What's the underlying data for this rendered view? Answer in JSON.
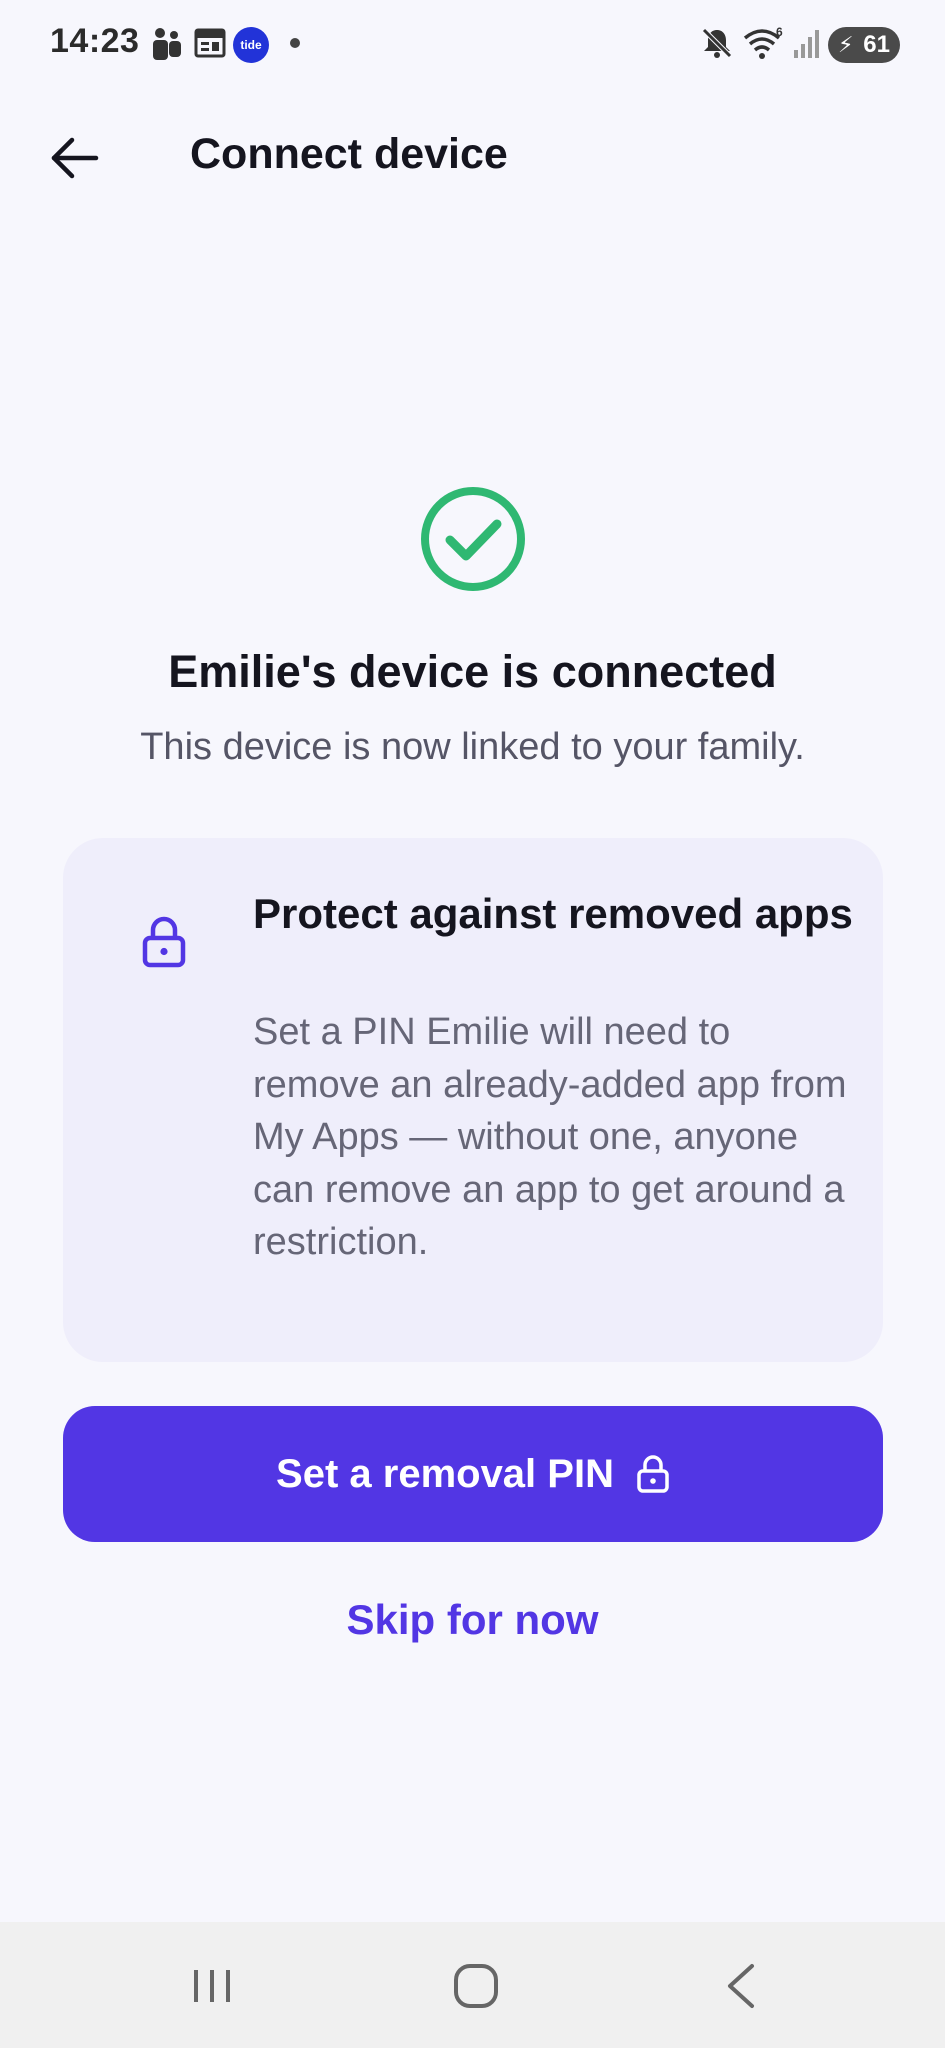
{
  "status_bar": {
    "time": "14:23",
    "icons": [
      "teams-icon",
      "calendar-icon",
      "tide-app-icon",
      "notification-dot",
      "mute-icon",
      "wifi-icon",
      "signal-icon"
    ],
    "tide_label": "tide",
    "battery": "61"
  },
  "header": {
    "title": "Connect device"
  },
  "success": {
    "title": "Emilie's device is connected",
    "subtitle": "This device is now linked to your family."
  },
  "card": {
    "title": "Protect against removed apps",
    "body": "Set a PIN Emilie will need to remove an already-added app from My Apps — without one, anyone can remove an app to get around a restriction."
  },
  "actions": {
    "primary_label": "Set a removal PIN",
    "skip_label": "Skip for now"
  },
  "colors": {
    "accent": "#5236e4",
    "success": "#2fb872",
    "card_bg": "#efeefb",
    "page_bg": "#f7f7fd"
  }
}
